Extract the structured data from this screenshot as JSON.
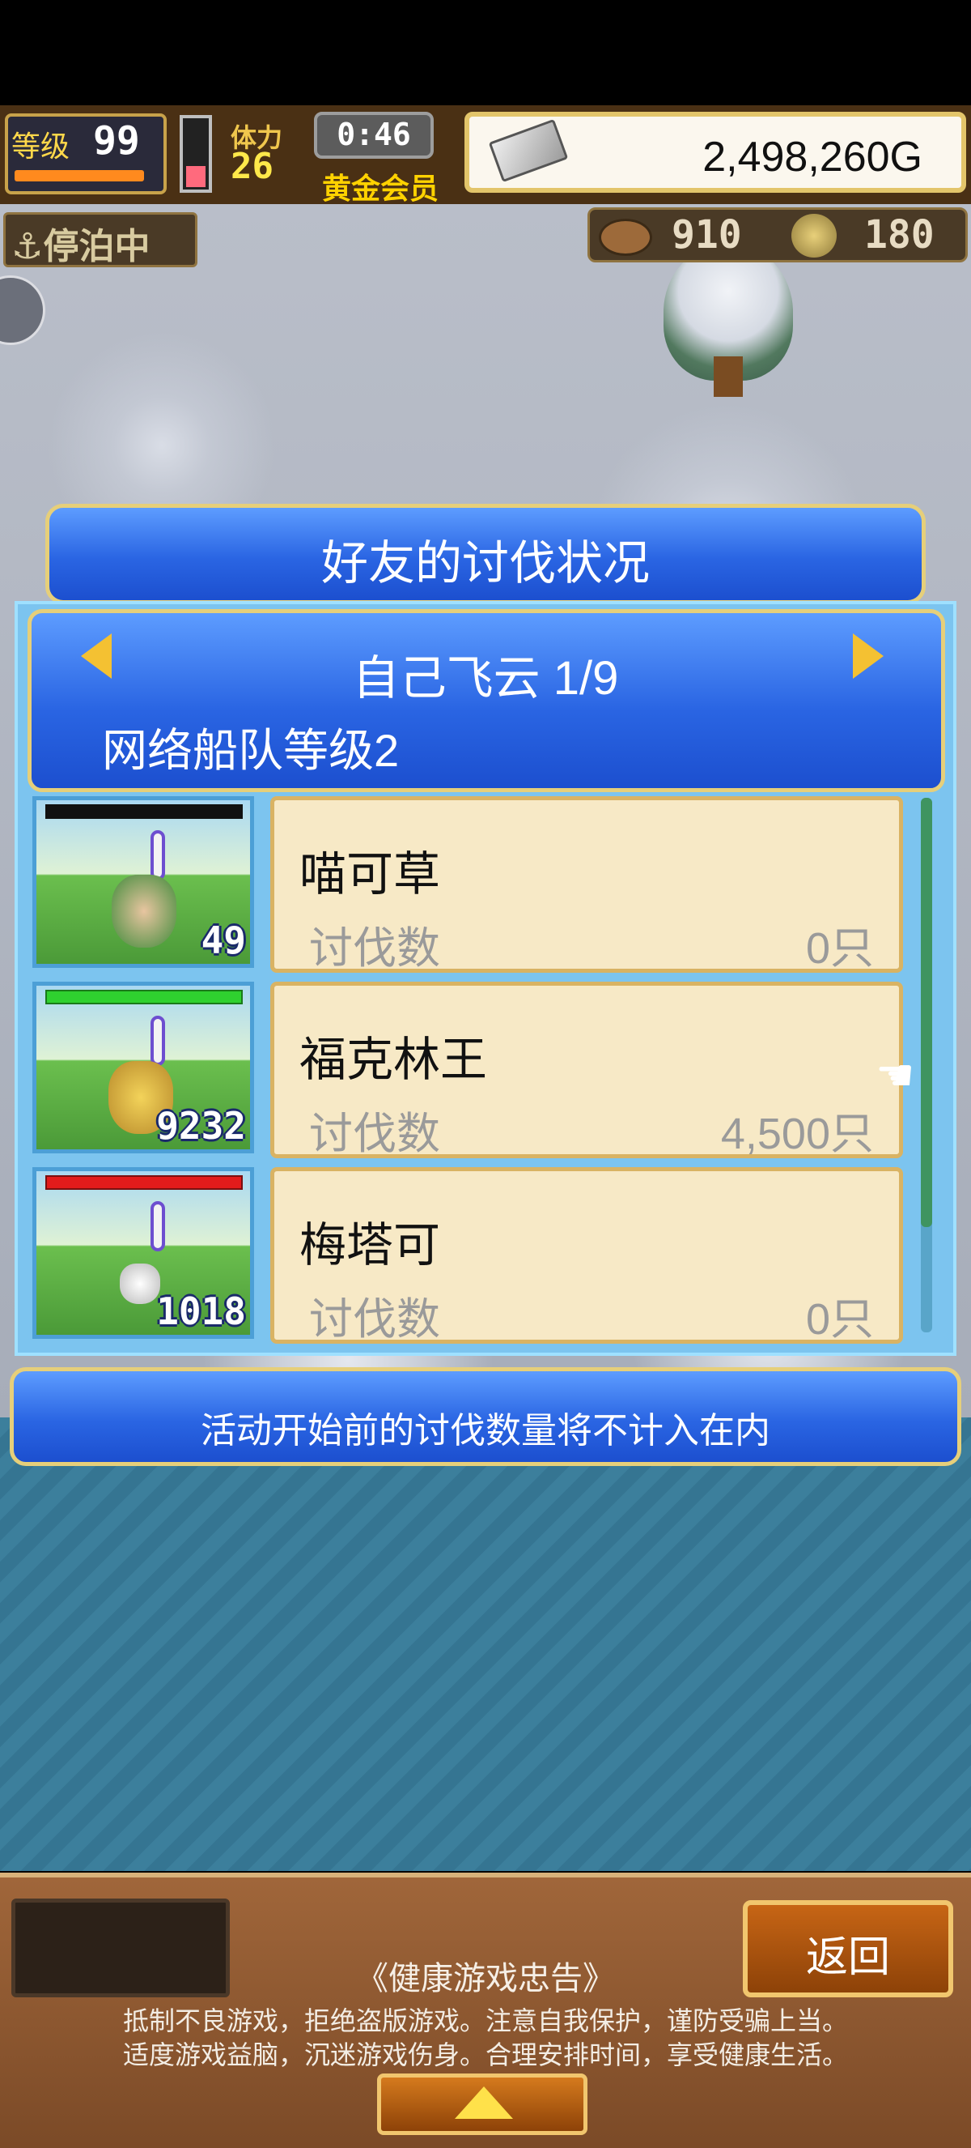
{
  "hud": {
    "level_label": "等级",
    "level_value": "99",
    "stamina_label": "体力",
    "stamina_value": "26",
    "timer": "0:46",
    "member_label": "黄金会员",
    "gold": "2,498,260G",
    "anchor_status": "停泊中",
    "wood": "910",
    "coin": "180"
  },
  "dialog": {
    "title": "好友的讨伐状况",
    "player": "自己飞云 1/9",
    "fleet_level": "网络船队等级2",
    "kill_label": "讨伐数",
    "monsters": [
      {
        "name": "喵可草",
        "kills": "0只",
        "badge": "49",
        "hp_color": "#111111"
      },
      {
        "name": "福克林王",
        "kills": "4,500只",
        "badge": "9232",
        "hp_color": "#2fd12f"
      },
      {
        "name": "梅塔可",
        "kills": "0只",
        "badge": "1018",
        "hp_color": "#e21b1b"
      }
    ],
    "note": "活动开始前的讨伐数量将不计入在内"
  },
  "bottom": {
    "back_label": "返回",
    "notice_title": "《健康游戏忠告》",
    "notice_line1": "抵制不良游戏，拒绝盗版游戏。注意自我保护，谨防受骗上当。",
    "notice_line2": "适度游戏益脑，沉迷游戏伤身。合理安排时间，享受健康生活。"
  },
  "icons": [
    "anchor-icon",
    "silver-ingot-icon",
    "wood-icon",
    "coin-icon",
    "arrow-left-icon",
    "arrow-right-icon",
    "hand-pointer-icon",
    "arrow-up-icon"
  ]
}
